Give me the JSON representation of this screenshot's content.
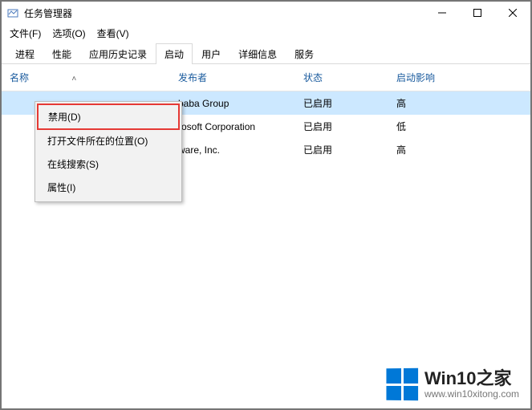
{
  "titlebar": {
    "title": "任务管理器"
  },
  "menubar": {
    "items": [
      "文件(F)",
      "选项(O)",
      "查看(V)"
    ]
  },
  "tabs": {
    "items": [
      {
        "label": "进程",
        "active": false
      },
      {
        "label": "性能",
        "active": false
      },
      {
        "label": "应用历史记录",
        "active": false
      },
      {
        "label": "启动",
        "active": true
      },
      {
        "label": "用户",
        "active": false
      },
      {
        "label": "详细信息",
        "active": false
      },
      {
        "label": "服务",
        "active": false
      }
    ]
  },
  "table": {
    "headers": {
      "name": "名称",
      "publisher": "发布者",
      "status": "状态",
      "impact": "启动影响"
    },
    "rows": [
      {
        "name": "",
        "publisher_visible": "baba Group",
        "status": "已启用",
        "impact": "高",
        "selected": true
      },
      {
        "name": "",
        "publisher_visible": "rosoft Corporation",
        "status": "已启用",
        "impact": "低",
        "selected": false
      },
      {
        "name": "",
        "publisher_visible": "ware, Inc.",
        "status": "已启用",
        "impact": "高",
        "selected": false
      }
    ]
  },
  "context_menu": {
    "items": [
      "禁用(D)",
      "打开文件所在的位置(O)",
      "在线搜索(S)",
      "属性(I)"
    ]
  },
  "watermark": {
    "text": "Win10之家",
    "url": "www.win10xitong.com"
  }
}
